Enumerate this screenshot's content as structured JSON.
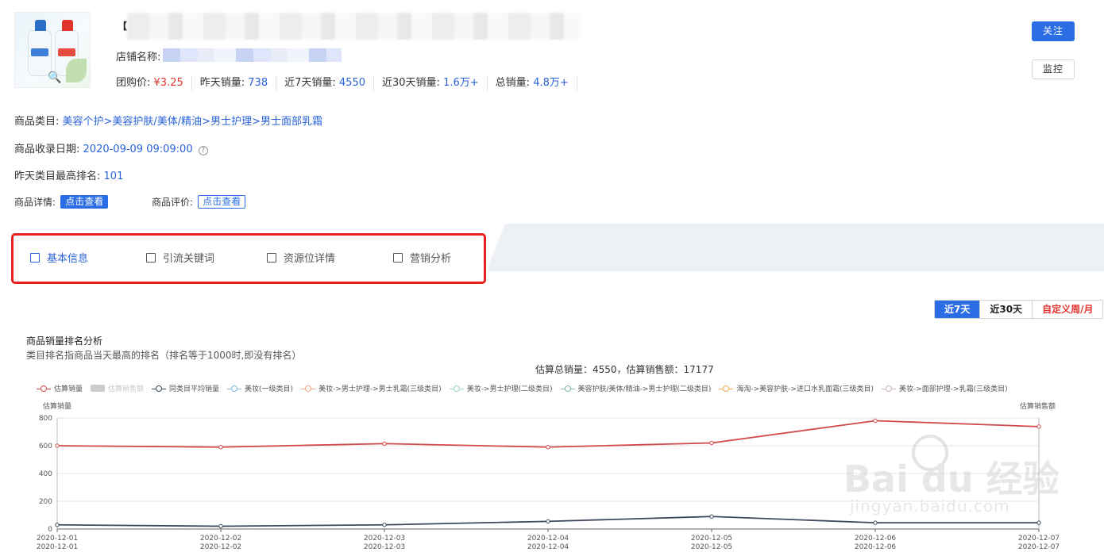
{
  "product": {
    "title_prefix": "【",
    "shop_label": "店铺名称:",
    "stats": [
      {
        "label": "团购价:",
        "value": "¥3.25",
        "color": "red"
      },
      {
        "label": "昨天销量:",
        "value": "738"
      },
      {
        "label": "近7天销量:",
        "value": "4550"
      },
      {
        "label": "近30天销量:",
        "value": "1.6万+"
      },
      {
        "label": "总销量:",
        "value": "4.8万+"
      }
    ]
  },
  "actions": {
    "follow": "关注",
    "monitor": "监控"
  },
  "info": {
    "category_label": "商品类目:",
    "category_value": "美容个护>美容护肤/美体/精油>男士护理>男士面部乳霜",
    "collected_label": "商品收录日期:",
    "collected_value": "2020-09-09 09:09:00",
    "rank_label": "昨天类目最高排名:",
    "rank_value": "101",
    "detail_label": "商品详情:",
    "detail_btn": "点击查看",
    "review_label": "商品评价:",
    "review_btn": "点击查看"
  },
  "tabs": [
    {
      "label": "基本信息",
      "icon": "clipboard-icon",
      "active": true
    },
    {
      "label": "引流关键词",
      "icon": "search-doc-icon"
    },
    {
      "label": "资源位详情",
      "icon": "window-icon"
    },
    {
      "label": "营销分析",
      "icon": "chart-icon"
    }
  ],
  "ranges": [
    {
      "label": "近7天",
      "active": true
    },
    {
      "label": "近30天"
    },
    {
      "label": "自定义周/月",
      "color": "#e3342f"
    }
  ],
  "chart_header": {
    "title": "商品销量排名分析",
    "subtitle": "类目排名指商品当天最高的排名（排名等于1000时,即没有排名）",
    "summary": "估算总销量：4550，估算销售额：17177"
  },
  "colors": {
    "accent": "#2b6de5",
    "price_red": "#e3342f",
    "highlight_red": "#e8201f"
  },
  "chart_data": {
    "type": "line",
    "x": [
      "2020-12-01",
      "2020-12-02",
      "2020-12-03",
      "2020-12-04",
      "2020-12-05",
      "2020-12-06",
      "2020-12-07"
    ],
    "ylabel_left": "估算销量",
    "ylabel_right": "估算销售额",
    "ylim": [
      0,
      800
    ],
    "yticks": [
      0,
      200,
      400,
      600,
      800
    ],
    "grid": true,
    "legend_position": "top",
    "legend": [
      {
        "name": "估算销量",
        "color": "#d14a4a"
      },
      {
        "name": "估算销售额",
        "color": "#cccccc",
        "marker": "rect",
        "dimmed": true
      },
      {
        "name": "同类目平均销量",
        "color": "#3d4a5c"
      },
      {
        "name": "美妆(一级类目)",
        "color": "#7fb7d8"
      },
      {
        "name": "美妆->男士护理->男士乳霜(三级类目)",
        "color": "#f0a37d"
      },
      {
        "name": "美妆->男士护理(二级类目)",
        "color": "#9fd3cf"
      },
      {
        "name": "美容护肤/美体/精油->男士护理(二级类目)",
        "color": "#7fb8a8"
      },
      {
        "name": "海淘->美容护肤->进口水乳面霜(三级类目)",
        "color": "#f0b04c"
      },
      {
        "name": "美妆->面部护理->乳霜(三级类目)",
        "color": "#c7b6b6"
      }
    ],
    "series": [
      {
        "name": "估算销量",
        "color": "#d14a4a",
        "values": [
          600,
          590,
          615,
          590,
          620,
          780,
          738
        ]
      },
      {
        "name": "同类目平均销量",
        "color": "#3d4a5c",
        "values": [
          30,
          20,
          30,
          55,
          90,
          45,
          45
        ]
      }
    ]
  }
}
